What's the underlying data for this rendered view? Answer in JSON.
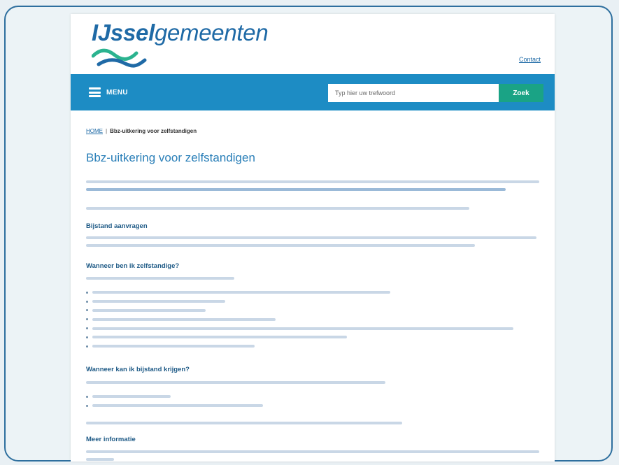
{
  "site": {
    "logo_text_part1": "IJssel",
    "logo_text_part2": "gemeenten",
    "contact_link": "Contact"
  },
  "nav": {
    "menu_label": "MENU",
    "search_placeholder": "Typ hier uw trefwoord",
    "search_button": "Zoek"
  },
  "breadcrumb": {
    "home": "HOME",
    "separator": "|",
    "current": "Bbz-uitkering voor zelfstandigen"
  },
  "page": {
    "title": "Bbz-uitkering voor zelfstandigen"
  },
  "sections": [
    {
      "heading": "Bijstand aanvragen"
    },
    {
      "heading": "Wanneer ben ik zelfstandige?"
    },
    {
      "heading": "Wanneer kan ik bijstand krijgen?"
    },
    {
      "heading": "Meer informatie"
    }
  ],
  "colors": {
    "brand_blue": "#1d8cc4",
    "search_green": "#1aa385",
    "title_blue": "#2a7fb8",
    "frame_border": "#2e6f9e"
  }
}
